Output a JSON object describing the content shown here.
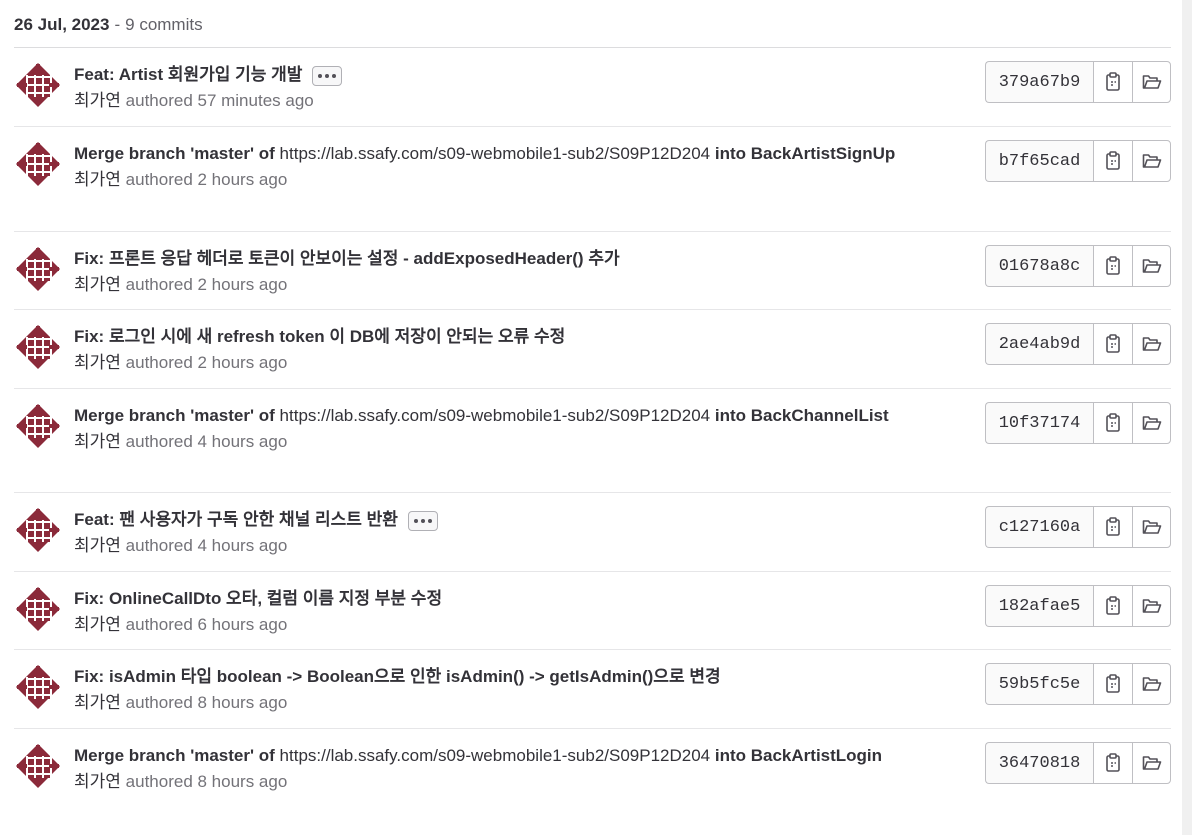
{
  "day": {
    "date": "26 Jul, 2023",
    "separator": "-",
    "count": "9 commits"
  },
  "icons": {
    "avatar": "identicon-avatar",
    "more": "ellipsis-icon",
    "copy": "copy-to-clipboard-icon",
    "browse": "folder-open-icon"
  },
  "colors": {
    "avatar": "#8b2a3a",
    "accent": "#333238"
  },
  "commits": [
    {
      "title": "Feat: Artist 회원가입 기능 개발",
      "has_more": true,
      "author": "최가연",
      "time": "authored 57 minutes ago",
      "sha": "379a67b9"
    },
    {
      "title_prefix": "Merge branch 'master' of",
      "title_url": "https://lab.ssafy.com/s09-webmobile1-sub2/S09P12D204",
      "title_suffix": "into BackArtistSignUp",
      "author": "최가연",
      "time": "authored 2 hours ago",
      "sha": "b7f65cad"
    },
    {
      "title": "Fix: 프론트 응답 헤더로 토큰이 안보이는 설정 - addExposedHeader() 추가",
      "author": "최가연",
      "time": "authored 2 hours ago",
      "sha": "01678a8c"
    },
    {
      "title": "Fix: 로그인 시에 새 refresh token 이 DB에 저장이 안되는 오류 수정",
      "author": "최가연",
      "time": "authored 2 hours ago",
      "sha": "2ae4ab9d"
    },
    {
      "title_prefix": "Merge branch 'master' of",
      "title_url": "https://lab.ssafy.com/s09-webmobile1-sub2/S09P12D204",
      "title_suffix": "into BackChannelList",
      "author": "최가연",
      "time": "authored 4 hours ago",
      "sha": "10f37174"
    },
    {
      "title": "Feat: 팬 사용자가 구독 안한 채널 리스트 반환",
      "has_more": true,
      "author": "최가연",
      "time": "authored 4 hours ago",
      "sha": "c127160a"
    },
    {
      "title": "Fix: OnlineCallDto 오타, 컬럼 이름 지정 부분 수정",
      "author": "최가연",
      "time": "authored 6 hours ago",
      "sha": "182afae5"
    },
    {
      "title": "Fix: isAdmin 타입 boolean -> Boolean으로 인한 isAdmin() -> getIsAdmin()으로 변경",
      "author": "최가연",
      "time": "authored 8 hours ago",
      "sha": "59b5fc5e"
    },
    {
      "title_prefix": "Merge branch 'master' of",
      "title_url": "https://lab.ssafy.com/s09-webmobile1-sub2/S09P12D204",
      "title_suffix": "into BackArtistLogin",
      "author": "최가연",
      "time": "authored 8 hours ago",
      "sha": "36470818"
    }
  ]
}
